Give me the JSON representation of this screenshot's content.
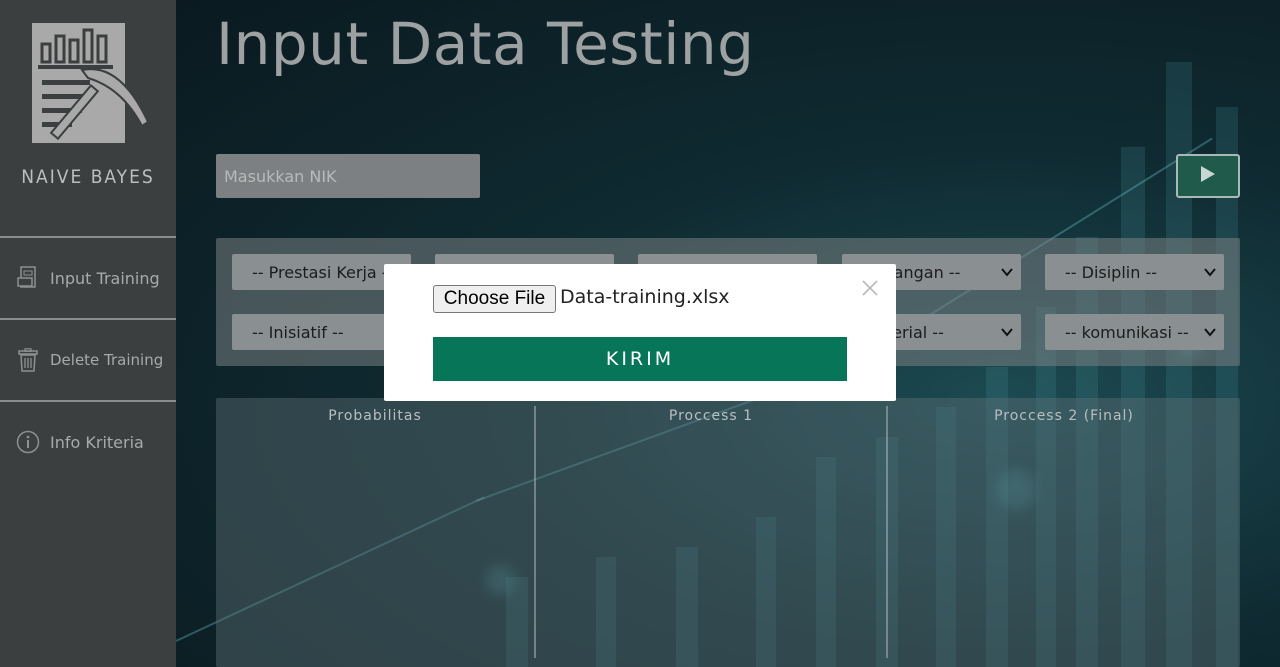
{
  "sidebar": {
    "brand": "NAIVE BAYES",
    "items": [
      {
        "label": "Input Training",
        "icon": "spreadsheet-icon"
      },
      {
        "label": "Delete Training",
        "icon": "trash-icon"
      },
      {
        "label": "Info Kriteria",
        "icon": "info-icon"
      }
    ]
  },
  "main": {
    "title": "Input Data Testing",
    "nik_placeholder": "Masukkan NIK",
    "criteria": {
      "row1": [
        "-- Prestasi Kerja --",
        "",
        "",
        "-- Kematangan --",
        "-- Disiplin --"
      ],
      "row1_visible": [
        "-- Prestasi Kerja --",
        "",
        "",
        "matangan --",
        "-- Disiplin --"
      ],
      "row2_visible": [
        "-- Inisiatif --",
        "",
        "",
        "nagerial --",
        "-- komunikasi --"
      ]
    },
    "results": {
      "columns": [
        "Probabilitas",
        "Proccess 1",
        "Proccess 2 (Final)"
      ]
    }
  },
  "modal": {
    "choose_file_label": "Choose File",
    "file_name": "Data-training.xlsx",
    "submit_label": "KIRIM"
  },
  "colors": {
    "accent": "#077658",
    "sidebar": "#3b3f40",
    "play_button": "#1f5a4a"
  }
}
